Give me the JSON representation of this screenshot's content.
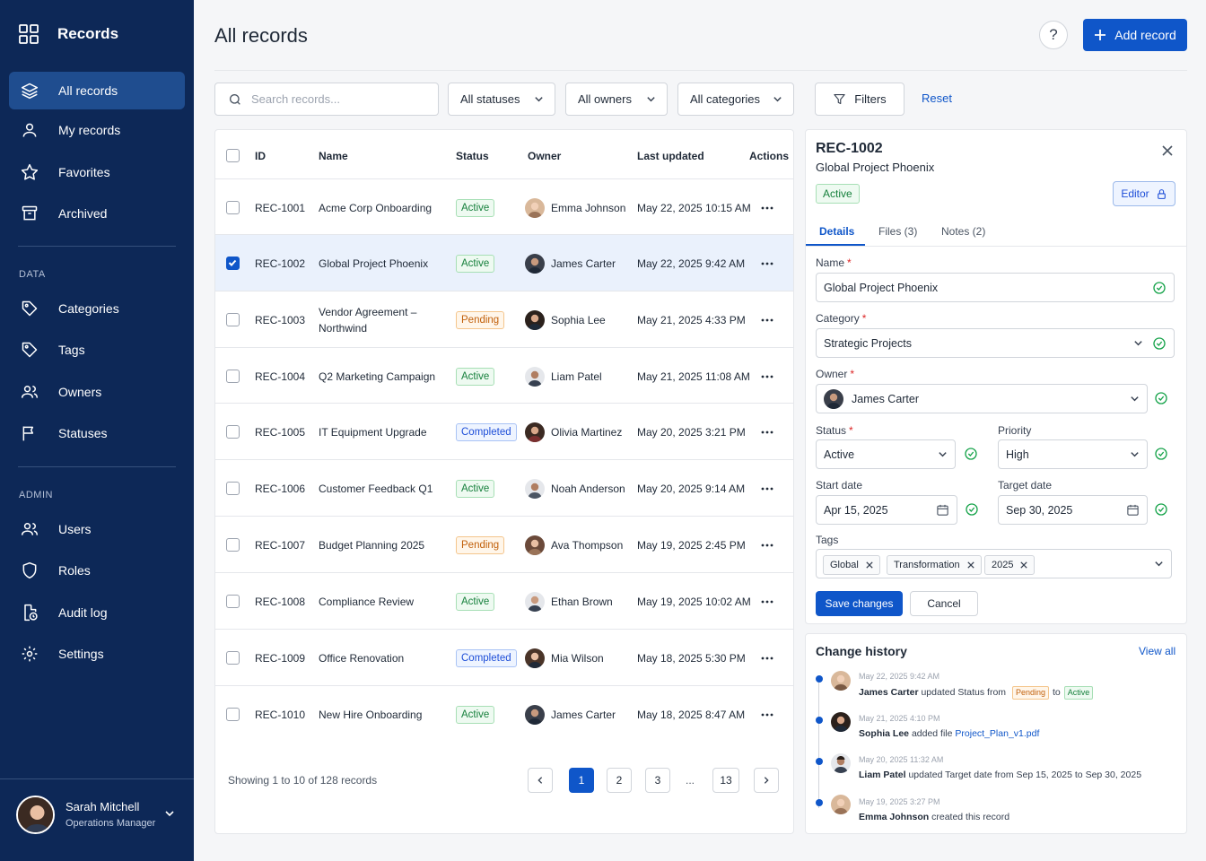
{
  "sidebar": {
    "brand": "Records",
    "nav": [
      {
        "label": "All records",
        "icon": "layers-icon"
      },
      {
        "label": "My records",
        "icon": "user-icon"
      },
      {
        "label": "Favorites",
        "icon": "star-icon"
      },
      {
        "label": "Archived",
        "icon": "archive-icon"
      }
    ],
    "data_section": "DATA",
    "data_items": [
      {
        "label": "Categories",
        "icon": "tag-icon"
      },
      {
        "label": "Tags",
        "icon": "tag-icon"
      },
      {
        "label": "Owners",
        "icon": "users-icon"
      },
      {
        "label": "Statuses",
        "icon": "flag-icon"
      }
    ],
    "admin_section": "ADMIN",
    "admin_items": [
      {
        "label": "Users",
        "icon": "users-icon"
      },
      {
        "label": "Roles",
        "icon": "shield-icon"
      },
      {
        "label": "Audit log",
        "icon": "file-clock-icon"
      },
      {
        "label": "Settings",
        "icon": "gear-icon"
      }
    ],
    "user": {
      "name": "Sarah Mitchell",
      "role": "Operations Manager"
    }
  },
  "header": {
    "title": "All records",
    "help": "?",
    "add_label": "Add record"
  },
  "filters": {
    "search_placeholder": "Search records...",
    "status": "All statuses",
    "owner": "All owners",
    "category": "All categories",
    "filters_label": "Filters",
    "reset_label": "Reset"
  },
  "table": {
    "columns": [
      "ID",
      "Name",
      "Status",
      "Owner",
      "Last updated",
      "Actions"
    ],
    "rows": [
      {
        "id": "REC-1001",
        "name": "Acme Corp Onboarding",
        "name2": "",
        "status": "Active",
        "owner": "Emma Johnson",
        "updated": "May 22, 2025 10:15 AM",
        "selected": false
      },
      {
        "id": "REC-1002",
        "name": "Global Project Phoenix",
        "name2": "",
        "status": "Active",
        "owner": "James Carter",
        "updated": "May 22, 2025 9:42 AM",
        "selected": true
      },
      {
        "id": "REC-1003",
        "name": "Vendor Agreement –",
        "name2": "Northwind",
        "status": "Pending",
        "owner": "Sophia Lee",
        "updated": "May 21, 2025 4:33 PM",
        "selected": false
      },
      {
        "id": "REC-1004",
        "name": "Q2 Marketing Campaign",
        "name2": "",
        "status": "Active",
        "owner": "Liam Patel",
        "updated": "May 21, 2025 11:08 AM",
        "selected": false
      },
      {
        "id": "REC-1005",
        "name": "IT Equipment Upgrade",
        "name2": "",
        "status": "Completed",
        "owner": "Olivia Martinez",
        "updated": "May 20, 2025 3:21 PM",
        "selected": false
      },
      {
        "id": "REC-1006",
        "name": "Customer Feedback Q1",
        "name2": "",
        "status": "Active",
        "owner": "Noah Anderson",
        "updated": "May 20, 2025 9:14 AM",
        "selected": false
      },
      {
        "id": "REC-1007",
        "name": "Budget Planning 2025",
        "name2": "",
        "status": "Pending",
        "owner": "Ava Thompson",
        "updated": "May 19, 2025 2:45 PM",
        "selected": false
      },
      {
        "id": "REC-1008",
        "name": "Compliance Review",
        "name2": "",
        "status": "Active",
        "owner": "Ethan Brown",
        "updated": "May 19, 2025 10:02 AM",
        "selected": false
      },
      {
        "id": "REC-1009",
        "name": "Office Renovation",
        "name2": "",
        "status": "Completed",
        "owner": "Mia Wilson",
        "updated": "May 18, 2025 5:30 PM",
        "selected": false
      },
      {
        "id": "REC-1010",
        "name": "New Hire Onboarding",
        "name2": "",
        "status": "Active",
        "owner": "James Carter",
        "updated": "May 18, 2025 8:47 AM",
        "selected": false
      }
    ],
    "pagination": {
      "summary": "Showing 1 to 10 of 128 records",
      "pages": [
        "1",
        "2",
        "3"
      ],
      "ellipsis": "...",
      "last": "13"
    }
  },
  "detail": {
    "id": "REC-1002",
    "name": "Global Project Phoenix",
    "status_badge": "Active",
    "editor_label": "Editor",
    "tabs": [
      "Details",
      "Files (3)",
      "Notes (2)"
    ],
    "name_label": "Name",
    "name_value": "Global Project Phoenix",
    "category_label": "Category",
    "category_value": "Strategic Projects",
    "owner_label": "Owner",
    "owner_value": "James Carter",
    "status_label": "Status",
    "status_value": "Active",
    "priority_label": "Priority",
    "priority_value": "High",
    "start_label": "Start date",
    "start_value": "Apr 15, 2025",
    "target_label": "Target date",
    "target_value": "Sep 30, 2025",
    "tags_label": "Tags",
    "tags": [
      "Global",
      "Transformation",
      "2025"
    ],
    "save_label": "Save changes",
    "cancel_label": "Cancel",
    "required_mark": "*"
  },
  "history": {
    "title": "Change history",
    "view_all": "View all",
    "entries": [
      {
        "time": "May 22, 2025 9:42 AM",
        "user": "James Carter",
        "action": "updated Status from",
        "from": "Pending",
        "to_word": "to",
        "to": "Active"
      },
      {
        "time": "May 21, 2025 4:10 PM",
        "user": "Sophia Lee",
        "action": "added file",
        "file": "Project_Plan_v1.pdf"
      },
      {
        "time": "May 20, 2025 11:32 AM",
        "user": "Liam Patel",
        "action": "updated Target date from Sep 15, 2025 to Sep 30, 2025"
      },
      {
        "time": "May 19, 2025 3:27 PM",
        "user": "Emma Johnson",
        "action": "created this record"
      }
    ]
  },
  "colors": {
    "primary": "#0f56c9",
    "sidebar": "#0d2857",
    "active": "#16803c",
    "pending": "#c2610c",
    "completed": "#1d4ed8"
  }
}
